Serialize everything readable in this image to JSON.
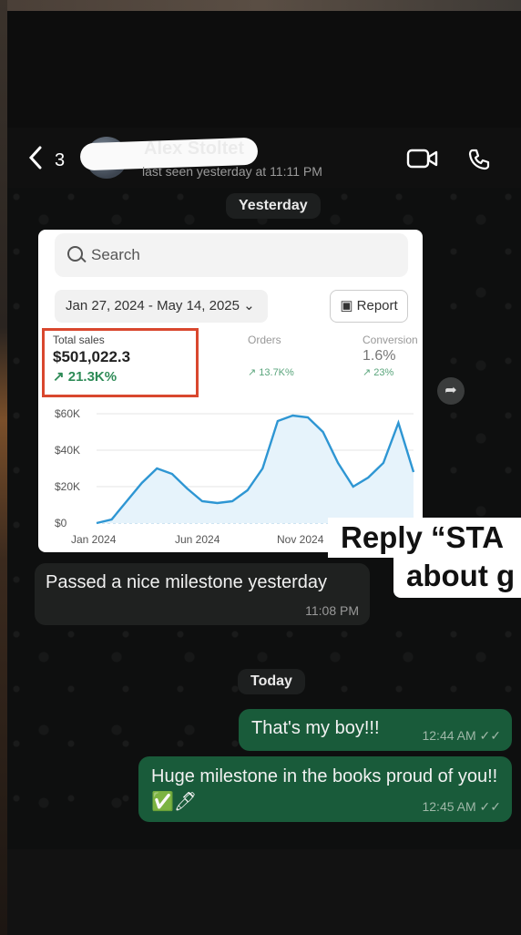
{
  "header": {
    "back_count": "3",
    "contact_name": "Alex Stoltet",
    "last_seen": "last seen yesterday at 11:11 PM",
    "icons": [
      "chevron-left-icon",
      "video-icon",
      "phone-icon"
    ]
  },
  "chat": {
    "date_yesterday": "Yesterday",
    "date_today": "Today",
    "image": {
      "search_placeholder": "Search",
      "date_range": "Jan 27, 2024 - May 14, 2025 ⌄",
      "report_label": "Report",
      "stats": [
        {
          "label": "Total sales",
          "value": "$501,022.3",
          "change": "↗ 21.3K%"
        },
        {
          "label": "Orders",
          "value": "",
          "change": "↗ 13.7K%"
        },
        {
          "label": "Conversion",
          "value": "1.6%",
          "change": "↗ 23%"
        }
      ],
      "chart_data": {
        "type": "area",
        "y_ticks": [
          "$60K",
          "$40K",
          "$20K",
          "$0"
        ],
        "x_ticks": [
          "Jan 2024",
          "Jun 2024",
          "Nov 2024"
        ],
        "ylim": [
          0,
          60000
        ],
        "series": [
          {
            "values": [
              0,
              2000,
              12000,
              22000,
              30000,
              27000,
              19000,
              12000,
              11000,
              12000,
              18000,
              30000,
              56000,
              59000,
              58000,
              50000,
              33000,
              20000,
              25000,
              33000,
              55000,
              28000
            ]
          }
        ],
        "accent": "#2e96d3"
      }
    },
    "messages": [
      {
        "text": "Passed a nice milestone yesterday",
        "time": "11:08 PM",
        "direction": "in"
      },
      {
        "text": "That's my boy!!!",
        "time": "12:44 AM",
        "direction": "out"
      },
      {
        "text": "Huge milestone in the books proud of you!! ✅🖊",
        "time": "12:45 AM",
        "direction": "out"
      }
    ]
  },
  "overlay": {
    "line1": "Reply “STA",
    "line2": "about g"
  },
  "colors": {
    "background": "#0e0f0f",
    "incoming_bubble": "#1f2120",
    "outgoing_bubble": "#195b3a",
    "highlight": "#d9472e"
  }
}
